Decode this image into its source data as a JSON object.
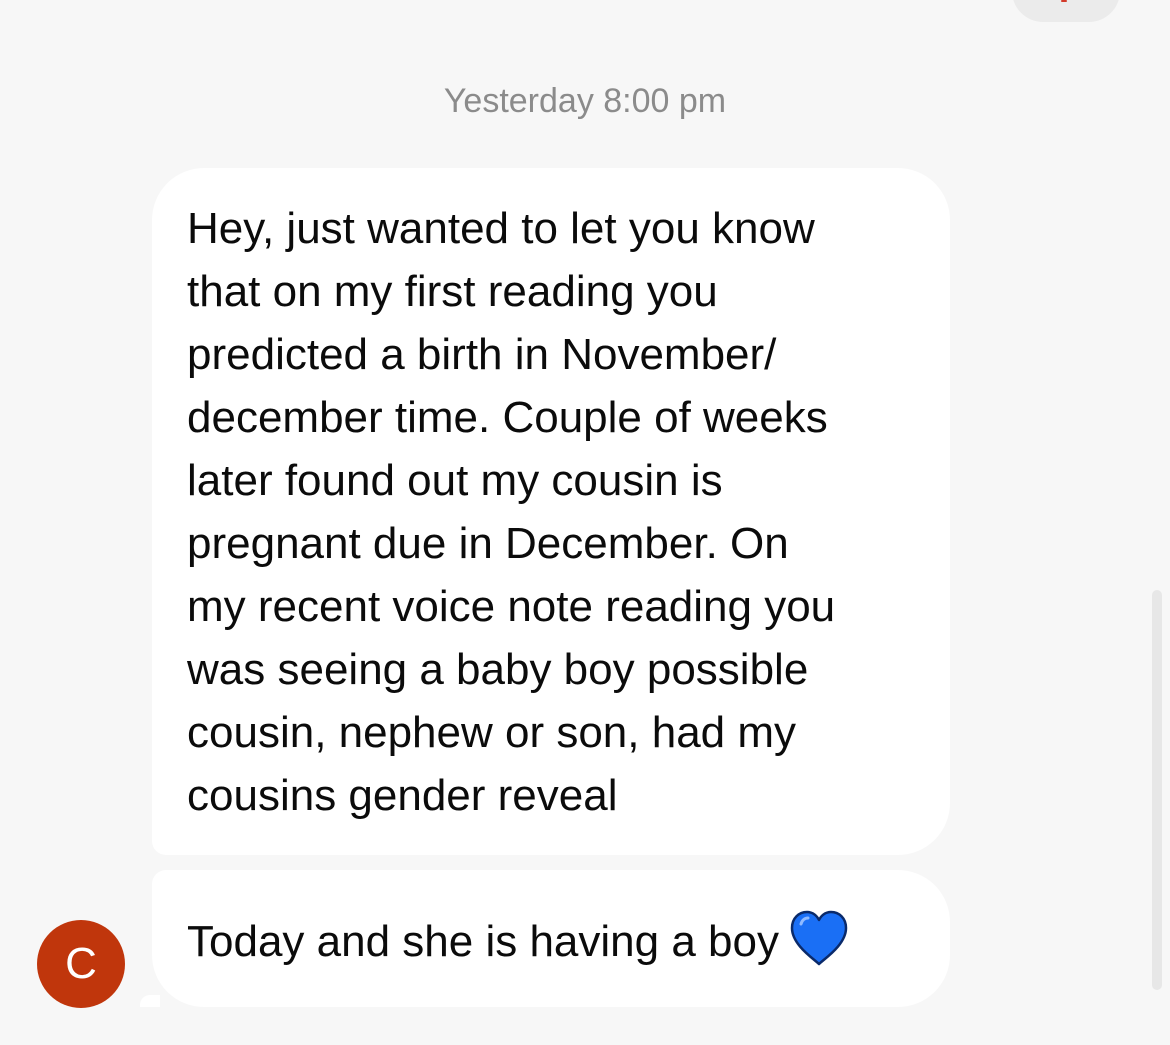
{
  "conversation": {
    "timestamp": "Yesterday 8:00 pm",
    "messages": [
      {
        "lines": [
          "Hey, just wanted to let you know",
          "that on my first reading you",
          "predicted a birth in November/",
          "december time. Couple of weeks",
          "later found out my cousin is",
          "pregnant due in December. On",
          "my recent voice note reading you",
          "was seeing a baby boy possible",
          "cousin, nephew or son, had my",
          "cousins gender reveal"
        ]
      },
      {
        "text": "Today and she is having a boy",
        "emoji_icon": "blue-heart-icon"
      }
    ]
  },
  "sender": {
    "initial": "C",
    "avatar_color": "#c0360c"
  },
  "colors": {
    "background": "#f7f7f7",
    "bubble": "#ffffff",
    "timestamp_text": "#8b8b8b",
    "message_text": "#0b0b0b",
    "heart": "#1a6ff5"
  }
}
